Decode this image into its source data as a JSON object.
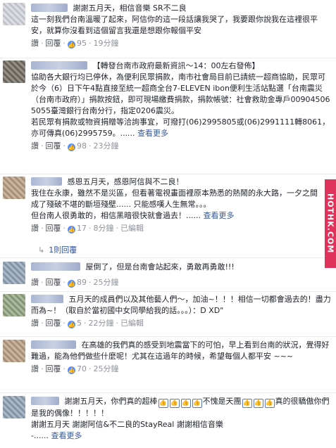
{
  "comments": [
    {
      "text": "謝謝五月天，相信音樂 SR不二良",
      "body": "這一刻我們台南溫暖了起來，阿信你的這一段話讓我哭了，我要跟你說我在這裡很平安，就算你沒看到這個留言我還是想跟你報個平安",
      "like_label": "讚",
      "reply_label": "回覆",
      "likes": "95",
      "time": "19分鐘"
    },
    {
      "text": "【轉發台南市政府最新資訊～14：00左右發佈】",
      "body": "協助各大銀行均已停休，為便利民眾捐款，南市社會局目前已請統一超商協助，民眾可於今（6）日下午4點直接至統一超商全台7-ELEVEN ibon便利生活站點選「台南震災（台南市政府）」捐款按鈕，即可現場繳費捐款，捐款帳號：社會救助金專戶009045065055臺灣銀行台南分行，指定0206震災。",
      "body2": "若民眾有捐款或物資捐贈等洽詢事宜，可撥打(06)2995805或(06)2991111轉8061，亦可傳真(06)2995759。......",
      "more": "查看更多",
      "like_label": "讚",
      "reply_label": "回覆",
      "likes": "98",
      "time": "23分鐘"
    },
    {
      "text": "感恩五月天，感恩阿信與不二良！",
      "body": "我住在永康，雖然不是災區，但看著電視畫面裡原本熟悉的熱鬧的永大路，一夕之間成了殘破不堪的斷垣殘壁...... 只能感嘆人生無常。。。",
      "body2": "但台南人很勇敢的，相信黑暗很快就會過去！......",
      "more": "查看更多",
      "like_label": "讚",
      "reply_label": "回覆",
      "likes": "17",
      "time": "8分鐘",
      "edited": "已編輯",
      "reply_count": "1則回覆"
    },
    {
      "text": "屋倒了，但是台南會站起來，勇敢再勇敢!!!",
      "like_label": "讚",
      "reply_label": "回覆",
      "likes": "89",
      "time": "25分鐘"
    },
    {
      "text": "五月天的成員們以及其他藝人們～，加油~！！！相信一切都會過去的！盡力而為~！（取自於當初國中女同學給我的話。。。）：D XD\"",
      "like_label": "讚",
      "reply_label": "回覆",
      "likes": "5",
      "time": "22分鐘",
      "edited": "已編輯"
    },
    {
      "text": "在高雄的我們真的感受到地震當下的可怕，早上看到台南的狀況，覺得好難過，能為他們做些什麼呢！尤其在這過年的時候，希望每個人都平安 ~~~",
      "like_label": "讚",
      "reply_label": "回覆",
      "likes": "70",
      "time": "25分鐘"
    },
    {
      "text_a": "謝謝五月天，你們真的超棒",
      "text_b": "不愧是天團",
      "text_c": "真的很驕傲你們是我的偶像！！！！！",
      "body": "謝謝五月天 謝謝阿信&不二良的StayReal 謝謝相信音樂",
      "body2": "-......",
      "more": "查看更多"
    }
  ],
  "watermark": "HOTHK.COM",
  "icons": {
    "like": "like-icon",
    "reply": "reply-arrow-icon",
    "thumb": "thumbs-up-icon"
  },
  "colors": {
    "link": "#365899",
    "muted": "#90949c",
    "like_blue": "#5890ff",
    "watermark_bg": "#e0335c"
  }
}
